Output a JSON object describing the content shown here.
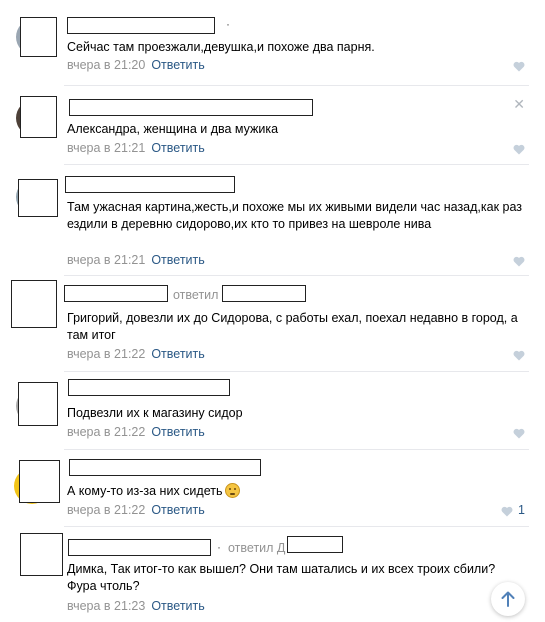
{
  "comments": [
    {
      "text": "Сейчас там проезжали,девушка,и похоже два парня.",
      "time": "вчера в 21:20",
      "reply_label": "Ответить"
    },
    {
      "text": "Александра, женщина и два мужика",
      "time": "вчера в 21:21",
      "reply_label": "Ответить"
    },
    {
      "text": "Там ужасная картина,жесть,и похоже мы их живыми видели час назад,как раз ездили в деревню сидорово,их кто то привез на шевроле нива",
      "time": "вчера в 21:21",
      "reply_label": "Ответить"
    },
    {
      "text": "Григорий, довезли их до Сидорова, с работы ехал, поехал недавно в город, а там итог",
      "time": "вчера в 21:22",
      "reply_label": "Ответить",
      "replied_label": "ответил"
    },
    {
      "text": "Подвезли их к магазину сидор",
      "time": "вчера в 21:22",
      "reply_label": "Ответить"
    },
    {
      "text": "А кому-то из-за них сидеть",
      "time": "вчера в 21:22",
      "reply_label": "Ответить",
      "likes": "1"
    },
    {
      "text": "Димка, Так итог-то как вышел? Они там шатались и их всех троих сбили? Фура чтоль?",
      "time": "вчера в 21:23",
      "reply_label": "Ответить",
      "replied_label": "ответил Д"
    }
  ],
  "colors": {
    "link": "#2a5885",
    "meta": "#939393",
    "divider": "#e7e8ec"
  },
  "icons": {
    "like": "heart-icon",
    "close": "close-icon",
    "scroll_up": "arrow-up-icon",
    "emoji": "worried-face-emoji"
  }
}
